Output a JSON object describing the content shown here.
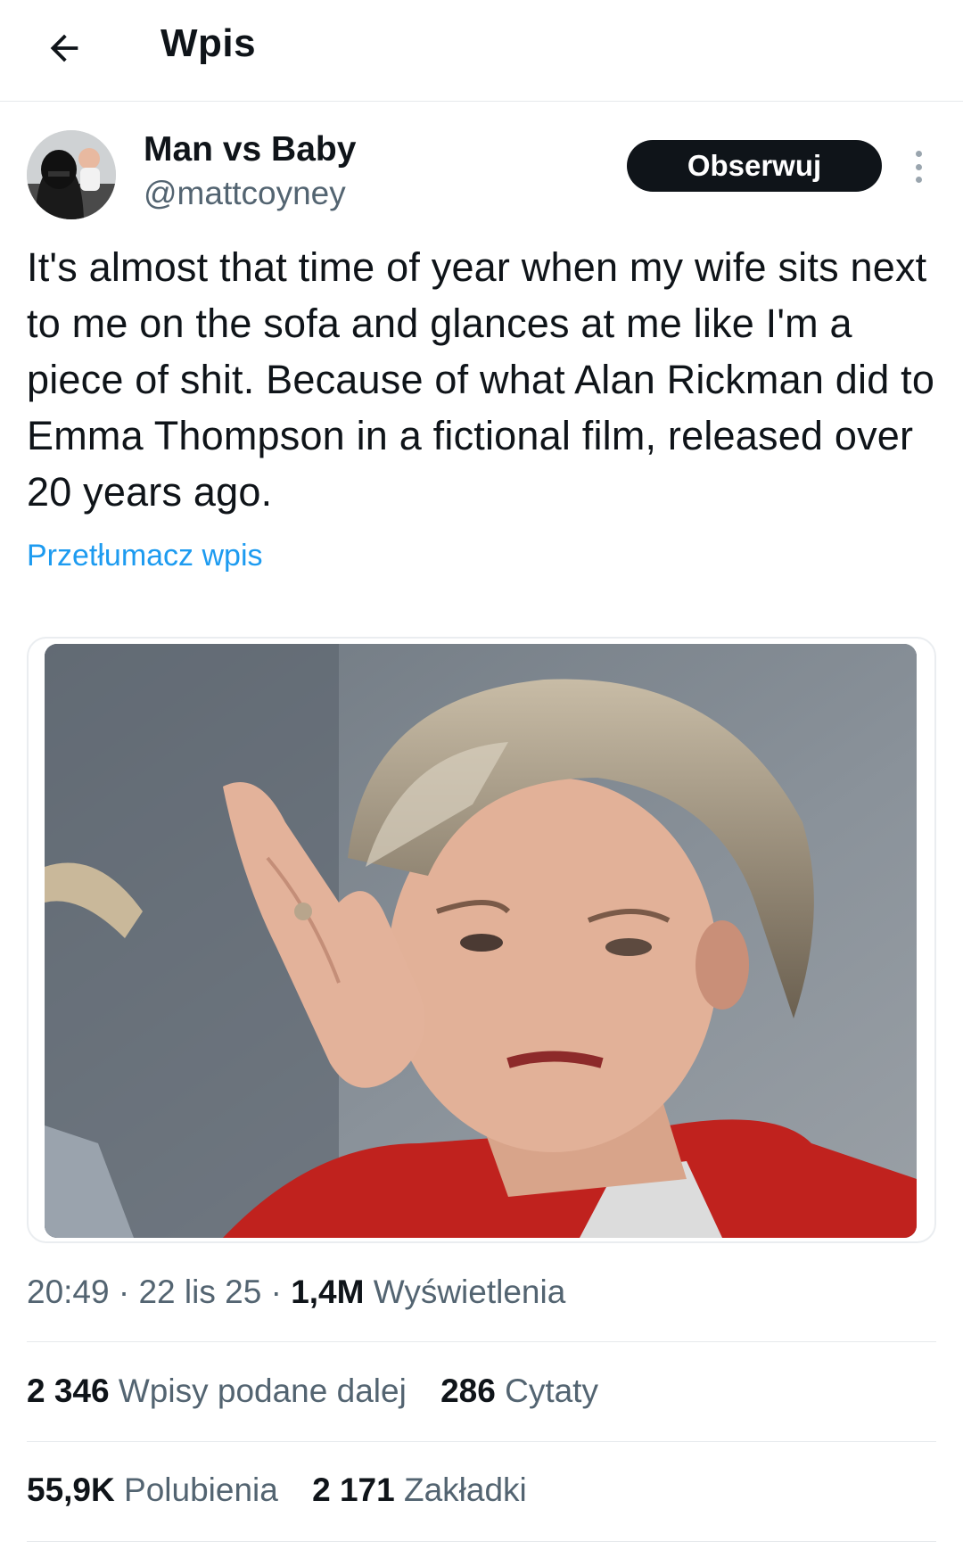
{
  "header": {
    "title": "Wpis",
    "back_icon": "arrow-left-icon"
  },
  "author": {
    "name": "Man vs Baby",
    "handle": "@mattcoyney",
    "follow_label": "Obserwuj",
    "more_icon": "more-vertical-icon"
  },
  "tweet": {
    "text": "It's almost that time of year when my wife sits next to me on the sofa and glances at me like I'm a piece of shit. Because of what Alan Rickman did to Emma Thompson in a fictional film, released over 20 years ago.",
    "translate_label": "Przetłumacz wpis"
  },
  "meta": {
    "time": "20:49",
    "date": "22 lis 25",
    "views_count": "1,4M",
    "views_label": "Wyświetlenia",
    "separator": " · "
  },
  "stats": {
    "reposts_count": "2 346",
    "reposts_label": "Wpisy podane dalej",
    "quotes_count": "286",
    "quotes_label": "Cytaty",
    "likes_count": "55,9K",
    "likes_label": "Polubienia",
    "bookmarks_count": "2 171",
    "bookmarks_label": "Zakładki"
  },
  "colors": {
    "text": "#0f1419",
    "secondary": "#536471",
    "link": "#1d9bf0",
    "divider": "#e6e9ec"
  }
}
